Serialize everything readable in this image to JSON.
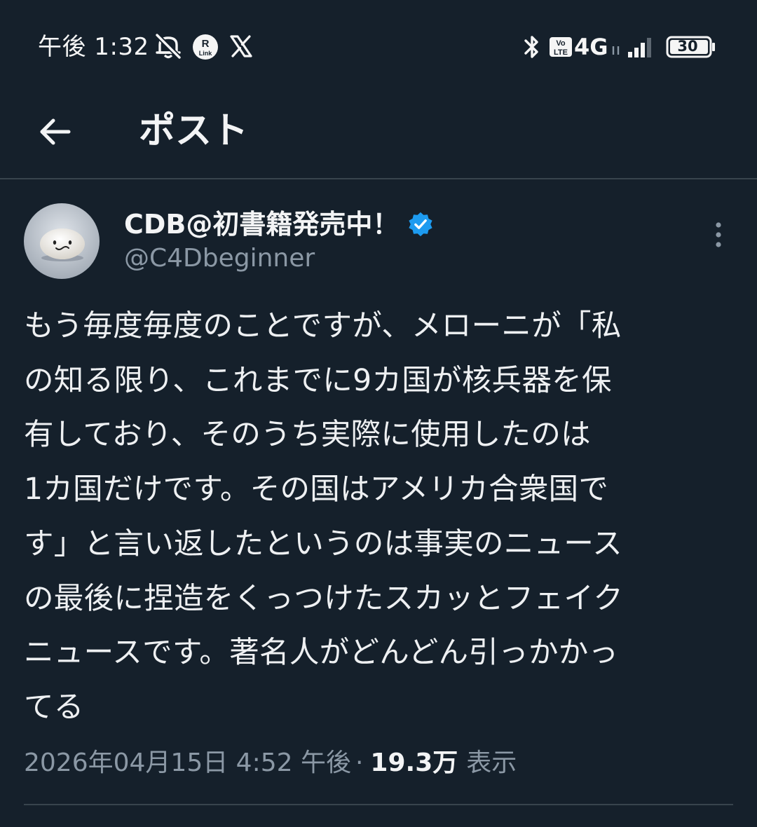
{
  "status_bar": {
    "time": "午後 1:32",
    "network": "4G",
    "volte_top": "Vo",
    "volte_bottom": "LTE",
    "rlink_top": "R",
    "rlink_bottom": "Link",
    "battery": "30",
    "icons": [
      "mute-icon",
      "rakuten-link-icon",
      "x-app-icon",
      "bluetooth-icon",
      "volte-icon",
      "data-arrows-icon",
      "signal-icon",
      "battery-icon"
    ]
  },
  "header": {
    "title": "ポスト",
    "back_icon": "arrow-left-icon"
  },
  "post": {
    "display_name": "CDB@初書籍発売中！",
    "handle": "@C4Dbeginner",
    "verified": true,
    "text": "もう毎度毎度のことですが、メローニが「私\nの知る限り、これまでに9カ国が核兵器を保\n有しており、そのうち実際に使用したのは\n1カ国だけです。その国はアメリカ合衆国で\nす」と言い返したというのは事実のニュース\nの最後に捏造をくっつけたスカッとフェイク\nニュースです。著名人がどんどん引っかかっ\nてる",
    "timestamp": "2026年04月15日 4:52 午後",
    "separator": "·",
    "views_count": "19.3万",
    "views_label": "表示"
  },
  "colors": {
    "background": "#15202b",
    "text_primary": "#e7e9ea",
    "text_secondary": "#8b98a5",
    "divider": "#38444d",
    "verified_blue": "#1d9bf0"
  }
}
